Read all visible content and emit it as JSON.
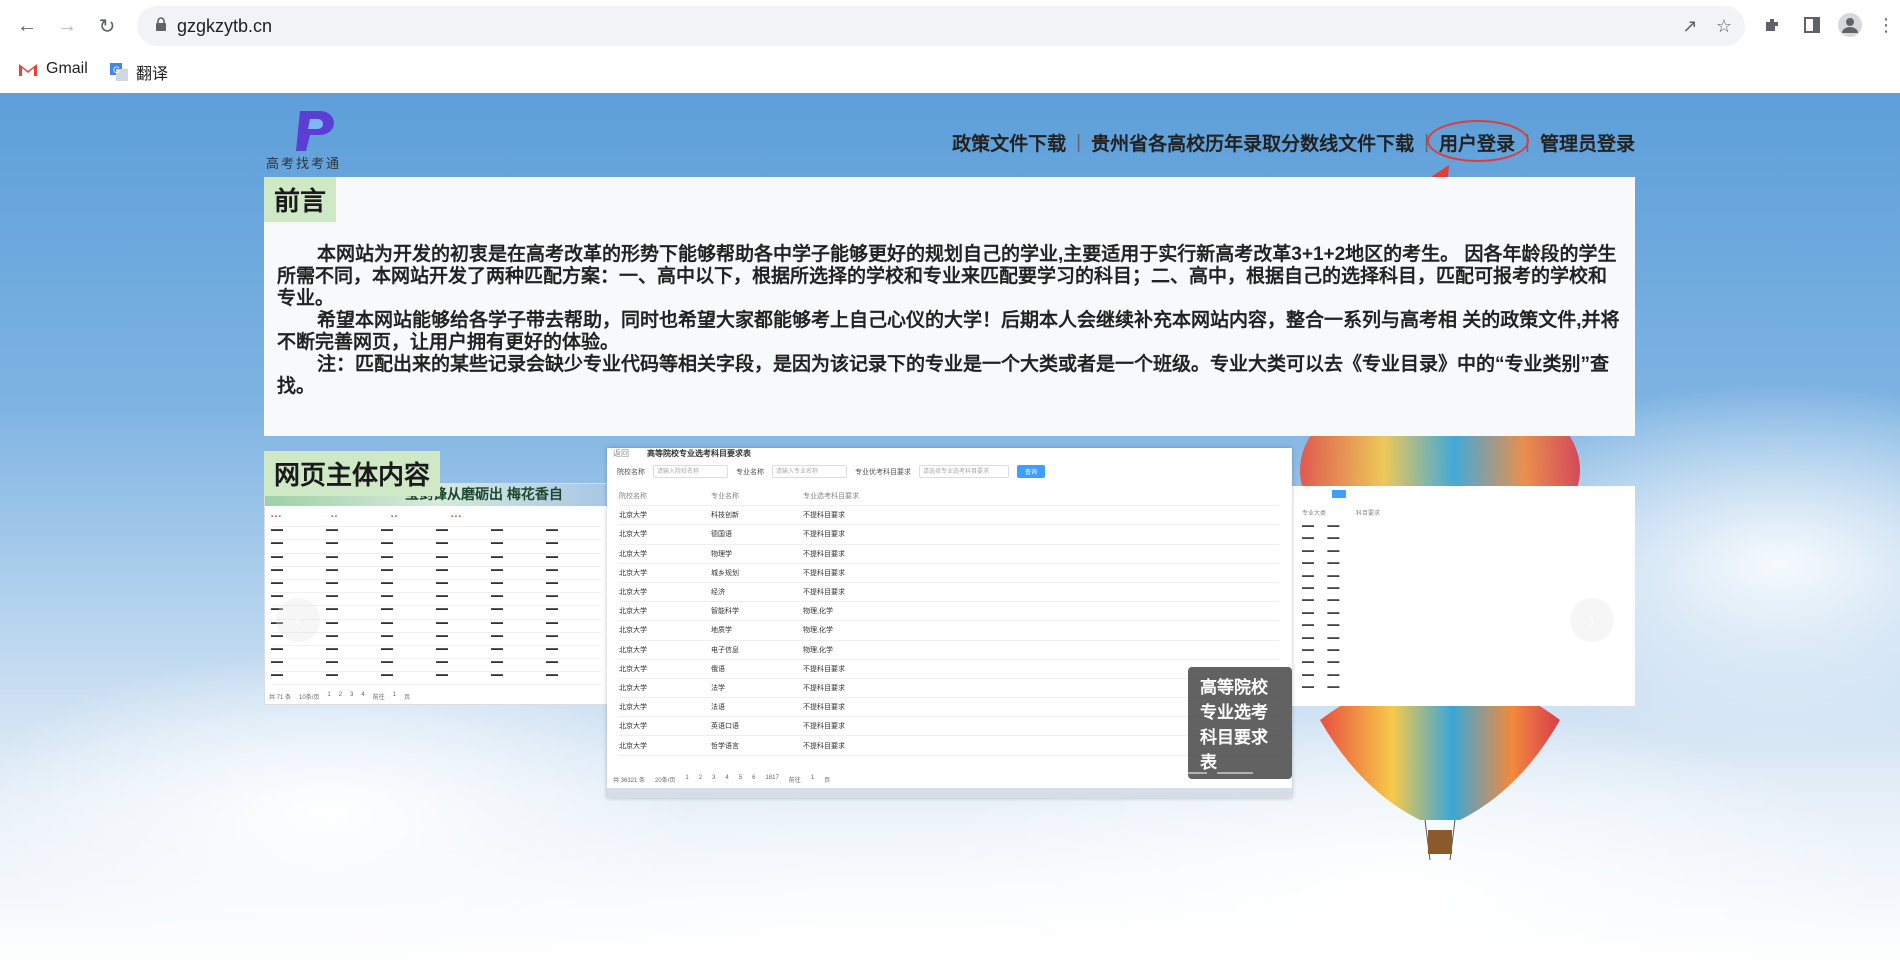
{
  "browser": {
    "url": "gzgkzytb.cn",
    "bookmarks": [
      {
        "label": "Gmail",
        "icon": "gmail-icon"
      },
      {
        "label": "翻译",
        "icon": "translate-icon"
      }
    ]
  },
  "site": {
    "logo_text": "高考找考通",
    "nav": {
      "policy": "政策文件下载",
      "scores": "贵州省各高校历年录取分数线文件下载",
      "user_login": "用户登录",
      "admin_login": "管理员登录"
    },
    "intro": {
      "tag": "前言",
      "para1": "本网站为开发的初衷是在高考改革的形势下能够帮助各中学子能够更好的规划自己的学业,主要适用于实行新高考改革3+1+2地区的考生。 因各年龄段的学生所需不同，本网站开发了两种匹配方案：一、高中以下，根据所选择的学校和专业来匹配要学习的科目；二、高中，根据自己的选择科目，匹配可报考的学校和专业。",
      "para2": "希望本网站能够给各学子带去帮助，同时也希望大家都能够考上自己心仪的大学！后期本人会继续补充本网站内容，整合一系列与高考相 关的政策文件,并将不断完善网页，让用户拥有更好的体验。",
      "para3": "注：匹配出来的某些记录会缺少专业代码等相关字段，是因为该记录下的专业是一个大类或者是一个班级。专业大类可以去《专业目录》中的“专业类别”查找。"
    },
    "main": {
      "tag": "网页主体内容",
      "caption": "高等院校专业选考科目要求表",
      "left_banner": "宝剑锋从磨砺出  梅花香自",
      "shot": {
        "back": "返回",
        "title": "高等院校专业选考科目要求表",
        "school_label": "院校名称",
        "school_placeholder": "请输入院校名称",
        "major_label": "专业名称",
        "major_placeholder": "请输入专业名称",
        "subject_label": "专业优考科目要求",
        "subject_placeholder": "请选择专业选考科目要求",
        "search": "查询",
        "headers": [
          "院校名称",
          "专业名称",
          "专业选考科目要求"
        ],
        "rows": [
          [
            "北京大学",
            "科技创新",
            "不提科目要求"
          ],
          [
            "北京大学",
            "德国语",
            "不提科目要求"
          ],
          [
            "北京大学",
            "物理学",
            "不提科目要求"
          ],
          [
            "北京大学",
            "城乡规划",
            "不提科目要求"
          ],
          [
            "北京大学",
            "经济",
            "不提科目要求"
          ],
          [
            "北京大学",
            "智能科学",
            "物理,化学"
          ],
          [
            "北京大学",
            "地质学",
            "物理,化学"
          ],
          [
            "北京大学",
            "电子信息",
            "物理,化学"
          ],
          [
            "北京大学",
            "俄语",
            "不提科目要求"
          ],
          [
            "北京大学",
            "法学",
            "不提科目要求"
          ],
          [
            "北京大学",
            "法语",
            "不提科目要求"
          ],
          [
            "北京大学",
            "英语口语",
            "不提科目要求"
          ],
          [
            "北京大学",
            "哲学语言",
            "不提科目要求"
          ]
        ],
        "pager": [
          "共 36321 条",
          "20条/页",
          "1",
          "2",
          "3",
          "4",
          "5",
          "6",
          "1817",
          "前往",
          "1",
          "页"
        ]
      },
      "left_pager": [
        "共 71 条",
        "10条/页",
        "1",
        "2",
        "3",
        "4",
        "前往",
        "1",
        "页"
      ],
      "right_headers": [
        "专业大类",
        "科目要求"
      ]
    }
  }
}
